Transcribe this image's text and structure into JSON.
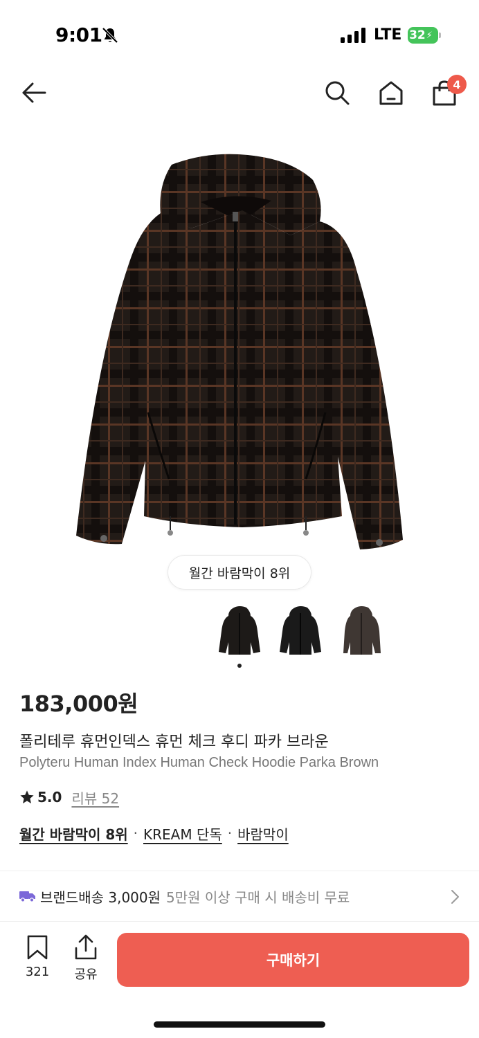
{
  "status": {
    "time": "9:01",
    "network": "LTE",
    "battery": "32"
  },
  "nav": {
    "cart_count": "4"
  },
  "product": {
    "rank_badge": "월간 바람막이 8위",
    "price": "183,000원",
    "name_ko": "폴리테루 휴먼인덱스 휴먼 체크 후디 파카 브라운",
    "name_en": "Polyteru Human Index Human Check Hoodie Parka Brown",
    "rating": "5.0",
    "review_label": "리뷰 52",
    "tags": [
      "월간 바람막이 8위",
      "KREAM 단독",
      "바람막이"
    ],
    "tag_separator": "·",
    "thumbnails": [
      {
        "color": "#1d1a18"
      },
      {
        "color": "#1a1a1a"
      },
      {
        "color": "#3f3733"
      }
    ],
    "selected_thumbnail": 1
  },
  "delivery": {
    "main": "브랜드배송 3,000원",
    "sub": "5만원 이상 구매 시 배송비 무료"
  },
  "bottom": {
    "bookmark_count": "321",
    "share_label": "공유",
    "buy_label": "구매하기"
  },
  "colors": {
    "accent": "#ee5e52",
    "badge": "#ee5a4b",
    "delivery_icon": "#7b68d8",
    "battery": "#44c45a"
  }
}
